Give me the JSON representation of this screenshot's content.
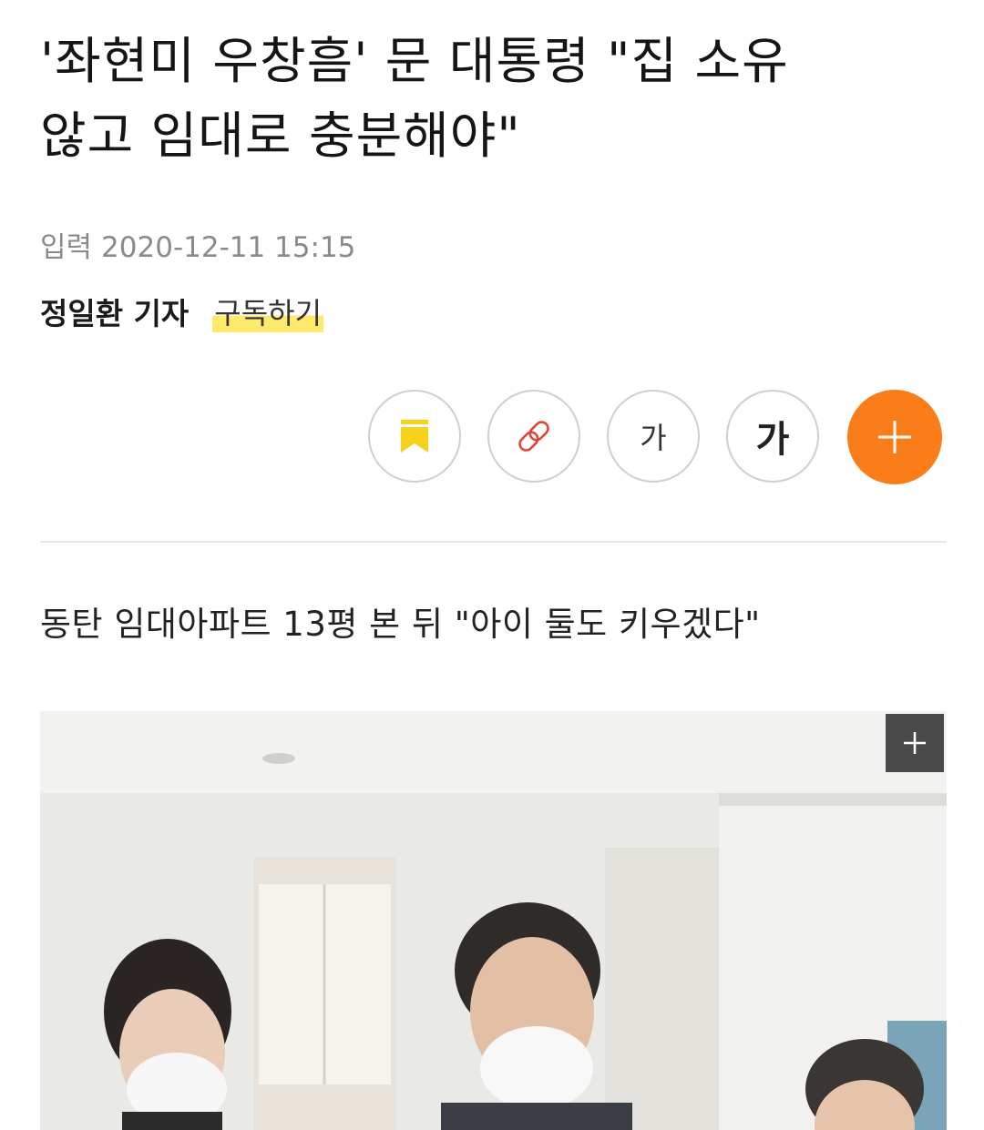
{
  "article": {
    "headline_line1": "'좌현미 우창흠' 문 대통령 \"집 소유",
    "headline_line2": "않고 임대로 충분해야\"",
    "input_label": "입력",
    "published_at": "2020-12-11 15:15",
    "reporter": "정일환 기자",
    "subscribe_label": "구독하기",
    "subheadline": "동탄 임대아파트 13평 본 뒤 \"아이 둘도 키우겠다\""
  },
  "toolbar": {
    "font_small_label": "가",
    "font_large_label": "가",
    "icons": [
      "bookmark-icon",
      "link-icon",
      "plus-icon"
    ]
  },
  "colors": {
    "accent_orange": "#fa7d1a",
    "bookmark_yellow": "#f7d21a",
    "link_red": "#e0453a",
    "subscribe_highlight": "#fde96a"
  }
}
